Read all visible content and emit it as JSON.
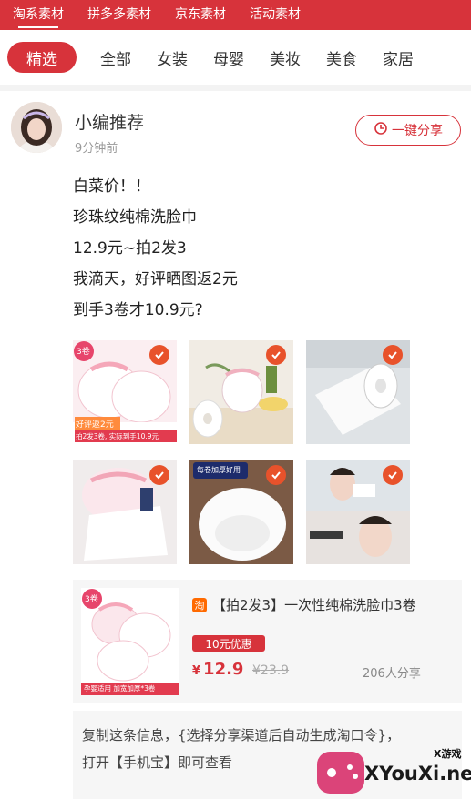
{
  "top_tabs": [
    "淘系素材",
    "拼多多素材",
    "京东素材",
    "活动素材"
  ],
  "categories": [
    "精选",
    "全部",
    "女装",
    "母婴",
    "美妆",
    "美食",
    "家居"
  ],
  "post": {
    "author": "小编推荐",
    "time": "9分钟前",
    "share_label": "一键分享",
    "lines": [
      "白菜价！！",
      "珍珠纹纯棉洗脸巾",
      "12.9元~拍2发3",
      "我滴天，好评晒图返2元",
      "到手3卷才10.9元?"
    ]
  },
  "images": {
    "img1_badge": "3卷",
    "img1_note": "好评返2元",
    "img1_foot": "拍2发3卷, 实际到手10.9元",
    "img5_banner": "每卷加厚好用"
  },
  "product": {
    "platform_badge": "淘",
    "title": "【拍2发3】一次性纯棉洗脸巾3卷",
    "coupon": "10元优惠",
    "currency": "¥",
    "price": "12.9",
    "original_price": "23.9",
    "share_count": "206人分享",
    "img_badge": "3卷",
    "img_foot": "孕婴适用 加宽加厚*3卷"
  },
  "copy_text": {
    "line1": "复制这条信息，{选择分享渠道后自动生成淘口令}，",
    "line2": "打开【手机宝】即可查看"
  },
  "watermark": {
    "small": "X游戏",
    "big": "XYouXi.net"
  },
  "colors": {
    "brand_red": "#d7333b",
    "check_orange": "#e8522b",
    "taobao_orange": "#ff6a00"
  }
}
